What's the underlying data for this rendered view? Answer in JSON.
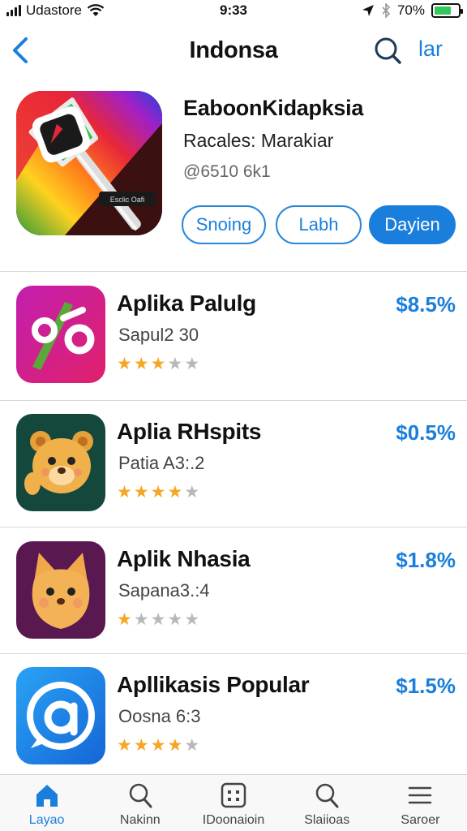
{
  "status_bar": {
    "carrier": "Udastore",
    "time": "9:33",
    "battery": "70%",
    "battery_level": 0.7
  },
  "nav": {
    "title": "Indonsa",
    "right_label": "lar"
  },
  "hero": {
    "title": "EaboonKidapksia",
    "subtitle": "Racales: Marakiar",
    "meta": "@6510 6k1",
    "icon_badge": "Esclic Oafi",
    "buttons": [
      "Snoing",
      "Labh",
      "Dayien"
    ]
  },
  "apps": [
    {
      "name": "Aplika Palulg",
      "subtitle": "Sapul2 30",
      "price": "$8.5%",
      "rating": 3
    },
    {
      "name": "Aplia RHspits",
      "subtitle": "Patia A3:.2",
      "price": "$0.5%",
      "rating": 4
    },
    {
      "name": "Aplik Nhasia",
      "subtitle": "Sapana3.:4",
      "price": "$1.8%",
      "rating": 1
    },
    {
      "name": "Apllikasis Popular",
      "subtitle": "Oosna 6:3",
      "price": "$1.5%",
      "rating": 4
    }
  ],
  "tabs": [
    {
      "label": "Layao",
      "icon": "home-icon",
      "active": true
    },
    {
      "label": "Nakinn",
      "icon": "search-icon",
      "active": false
    },
    {
      "label": "IDoonaioin",
      "icon": "grid-icon",
      "active": false
    },
    {
      "label": "Slaiioas",
      "icon": "search-icon",
      "active": false
    },
    {
      "label": "Saroer",
      "icon": "menu-icon",
      "active": false
    }
  ],
  "colors": {
    "accent": "#1a7fdc",
    "star": "#f5a623",
    "star_off": "#b8b8b8"
  }
}
